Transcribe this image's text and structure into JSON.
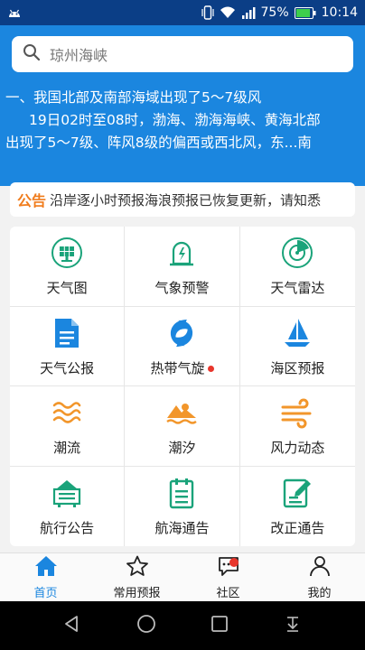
{
  "status_bar": {
    "battery": "75%",
    "time": "10:14"
  },
  "search": {
    "placeholder": "琼州海峡"
  },
  "alert": {
    "line1": "一、我国北部及南部海域出现了5～7级风",
    "line2": "19日02时至08时，渤海、渤海海峡、黄海北部",
    "line3": "出现了5～7级、阵风8级的偏西或西北风，东...南"
  },
  "notice": {
    "tag": "公告",
    "text": "沿岸逐小时预报海浪预报已恢复更新，请知悉"
  },
  "menu": [
    {
      "label": "天气图",
      "icon": "weather-map-icon",
      "color": "#1aa37a"
    },
    {
      "label": "气象预警",
      "icon": "weather-warning-icon",
      "color": "#1aa37a"
    },
    {
      "label": "天气雷达",
      "icon": "weather-radar-icon",
      "color": "#1aa37a"
    },
    {
      "label": "天气公报",
      "icon": "weather-bulletin-icon",
      "color": "#1b86df"
    },
    {
      "label": "热带气旋",
      "icon": "tropical-cyclone-icon",
      "color": "#1b86df"
    },
    {
      "label": "海区预报",
      "icon": "sea-forecast-icon",
      "color": "#1b86df"
    },
    {
      "label": "潮流",
      "icon": "tidal-current-icon",
      "color": "#f2962b"
    },
    {
      "label": "潮汐",
      "icon": "tide-icon",
      "color": "#f2962b"
    },
    {
      "label": "风力动态",
      "icon": "wind-dynamics-icon",
      "color": "#f2962b"
    },
    {
      "label": "航行公告",
      "icon": "navigation-notice-icon",
      "color": "#1aa37a"
    },
    {
      "label": "航海通告",
      "icon": "nautical-notice-icon",
      "color": "#1aa37a"
    },
    {
      "label": "改正通告",
      "icon": "correction-notice-icon",
      "color": "#1aa37a"
    }
  ],
  "tabs": [
    {
      "label": "首页",
      "icon": "home-icon"
    },
    {
      "label": "常用预报",
      "icon": "star-icon"
    },
    {
      "label": "社区",
      "icon": "chat-icon"
    },
    {
      "label": "我的",
      "icon": "user-icon"
    }
  ],
  "colors": {
    "primary": "#1b86df",
    "status_bar": "#0b3e86",
    "accent_orange": "#f07c1c",
    "badge_red": "#e8362c"
  }
}
